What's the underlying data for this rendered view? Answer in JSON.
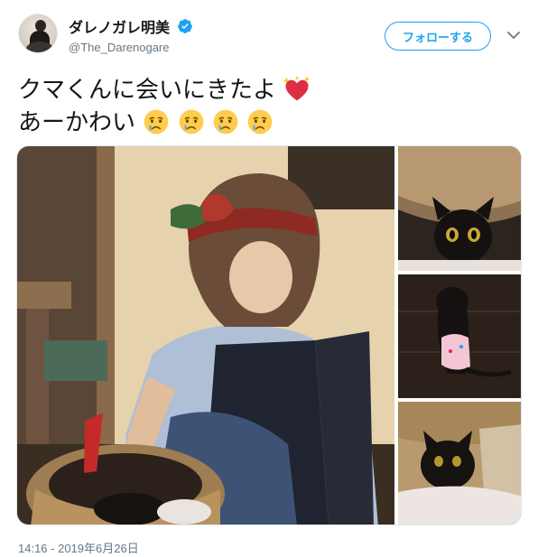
{
  "user": {
    "display_name": "ダレノガレ明美",
    "handle": "@The_Darenogare",
    "verified": true
  },
  "follow_button_label": "フォローする",
  "menu_icon": "chevron-down-icon",
  "tweet": {
    "line1_text": "クマくんに会いにきたよ",
    "line1_emoji": "heart-with-sparkles",
    "line2_text": "あーかわい",
    "line2_emoji": [
      "crying-face",
      "crying-face",
      "crying-face",
      "crying-face"
    ]
  },
  "media": [
    {
      "name": "photo-woman-petting-kitten"
    },
    {
      "name": "photo-black-kitten-closeup"
    },
    {
      "name": "photo-kitten-on-floor"
    },
    {
      "name": "photo-kitten-in-basket"
    }
  ],
  "timestamp": "14:16 - 2019年6月26日",
  "colors": {
    "accent": "#1da1f2",
    "text": "#14171a",
    "secondary_text": "#657786",
    "heart": "#e0245e"
  }
}
